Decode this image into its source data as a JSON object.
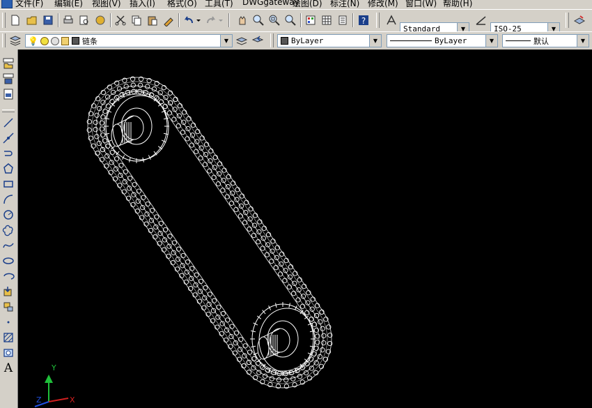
{
  "menu": {
    "file": "文件(F)",
    "edit": "编辑(E)",
    "view": "视图(V)",
    "insert": "插入(I)",
    "format": "格式(O)",
    "tools": "工具(T)",
    "dwggateway": "DWGgateway",
    "draw": "绘图(D)",
    "dimension": "标注(N)",
    "modify": "修改(M)",
    "window": "窗口(W)",
    "help": "帮助(H)"
  },
  "toolbar": {
    "text_style": "Standard",
    "dim_style": "ISO-25",
    "layer": "链条",
    "color": "ByLayer",
    "linetype": "ByLayer",
    "lineweight": "默认"
  },
  "side": {
    "text_tool": "A"
  },
  "ucs": {
    "x": "X",
    "y": "Y",
    "z": "Z"
  },
  "colors": {
    "canvas": "#000000",
    "chrome": "#d4d0c8",
    "wire": "#ffffff"
  }
}
